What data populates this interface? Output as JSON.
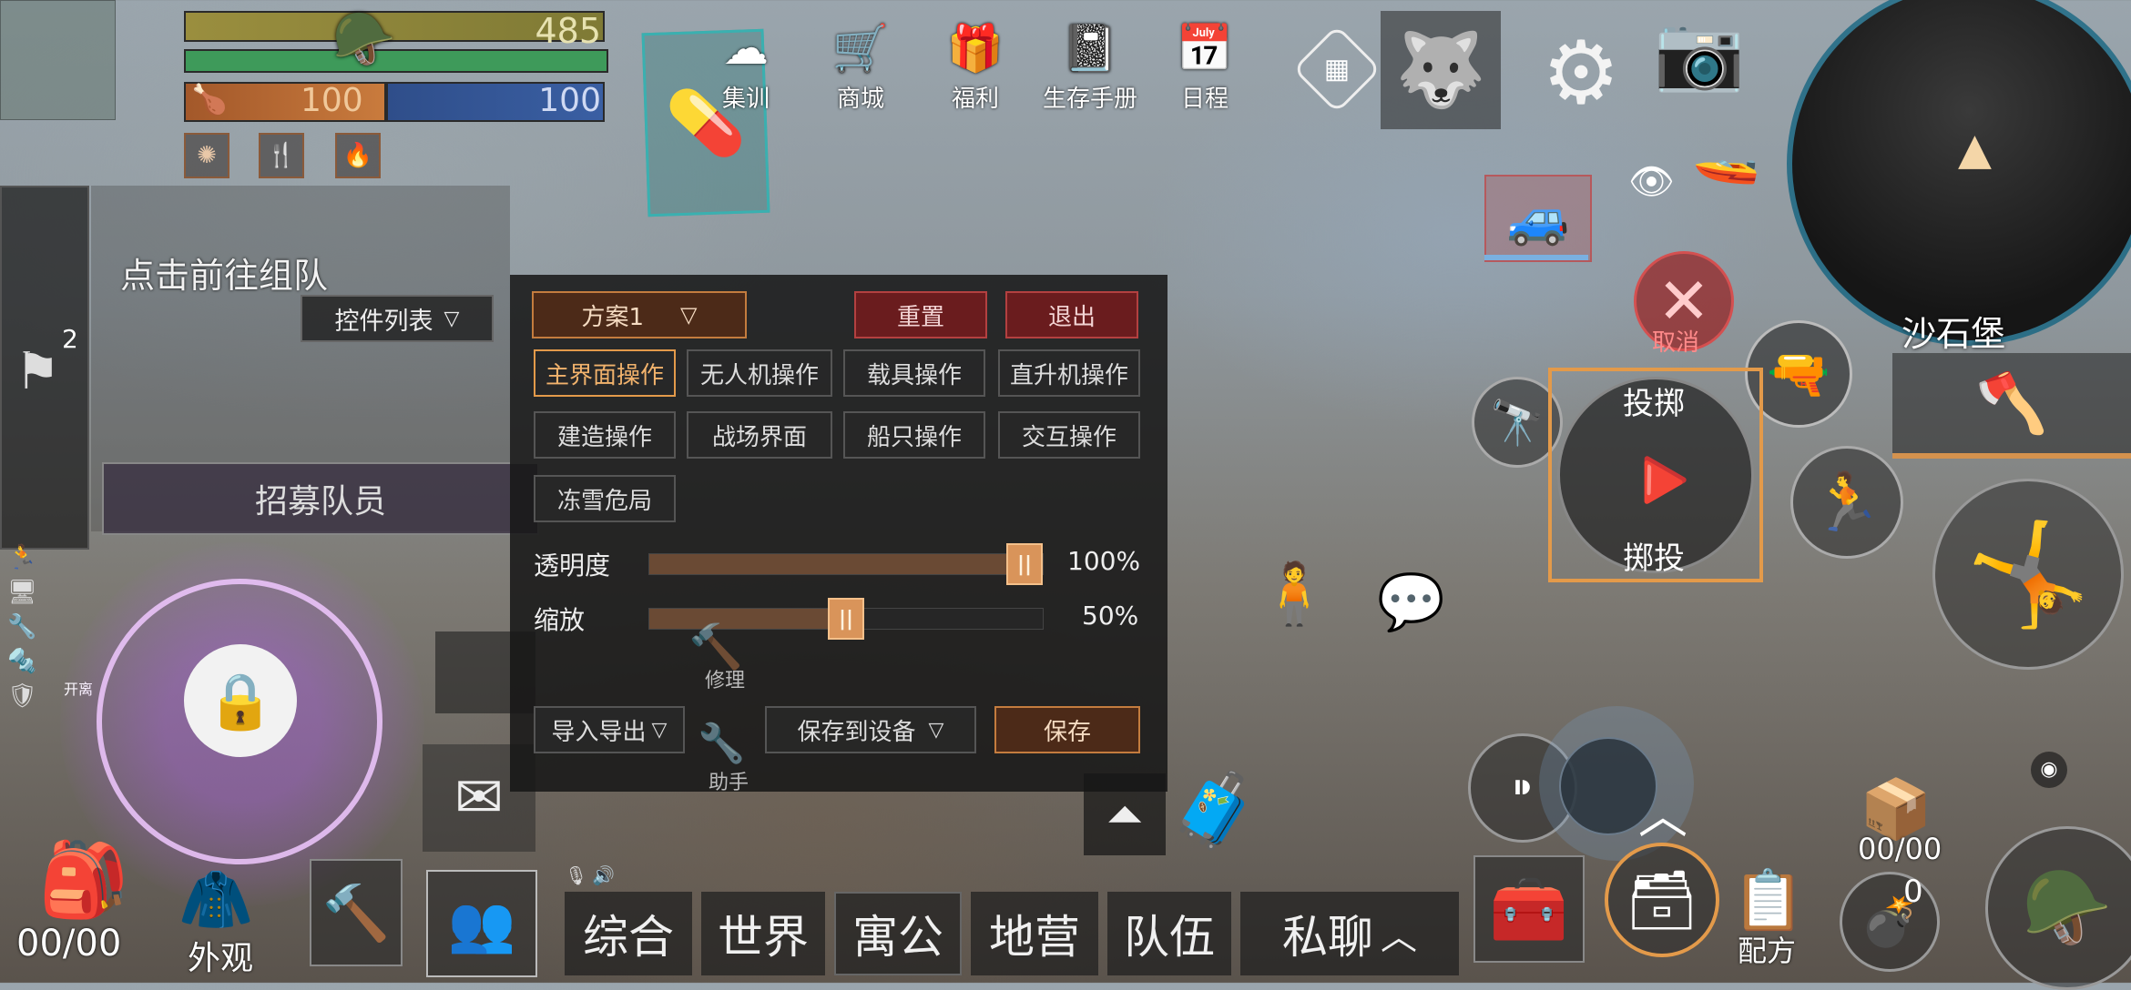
{
  "status": {
    "score": "485",
    "health": "100",
    "armor": "100"
  },
  "top_menu": [
    {
      "label": "集训",
      "icon": "⛰"
    },
    {
      "label": "商城",
      "icon": "🛒"
    },
    {
      "label": "福利",
      "icon": "🎁"
    },
    {
      "label": "生存手册",
      "icon": "📓"
    },
    {
      "label": "日程",
      "icon": "📅"
    }
  ],
  "team": {
    "prompt": "点击前往组队",
    "controls_dropdown": "控件列表",
    "recruit": "招募队员",
    "flag_count": "2"
  },
  "panel": {
    "scheme": "方案1",
    "reset": "重置",
    "exit": "退出",
    "tabs": [
      "主界面操作",
      "无人机操作",
      "载具操作",
      "直升机操作",
      "建造操作",
      "战场界面",
      "船只操作",
      "交互操作",
      "冻雪危局"
    ],
    "opacity_label": "透明度",
    "opacity_value": "100%",
    "opacity_level": 1.0,
    "scale_label": "缩放",
    "scale_value": "50%",
    "scale_level": 0.5,
    "import_export": "导入导出",
    "save_to_device": "保存到设备",
    "save": "保存",
    "repair": "修理",
    "assistant": "助手"
  },
  "left_side": {
    "leave": "开离"
  },
  "bottom_left": {
    "backpack_count": "00/00",
    "appearance": "外观"
  },
  "chat_tabs": [
    "综合",
    "世界",
    "寓公",
    "地营",
    "队伍",
    "私聊"
  ],
  "right": {
    "location": "沙石堡",
    "cancel": "取消",
    "throw_top": "投掷",
    "throw_bottom": "掷投",
    "ammo_count": "00/00",
    "grenade_count": "0",
    "recipe": "配方"
  },
  "colors": {
    "accent_orange": "#e39a4a",
    "danger_red": "#b34040",
    "purple_glow": "#b85cff"
  }
}
